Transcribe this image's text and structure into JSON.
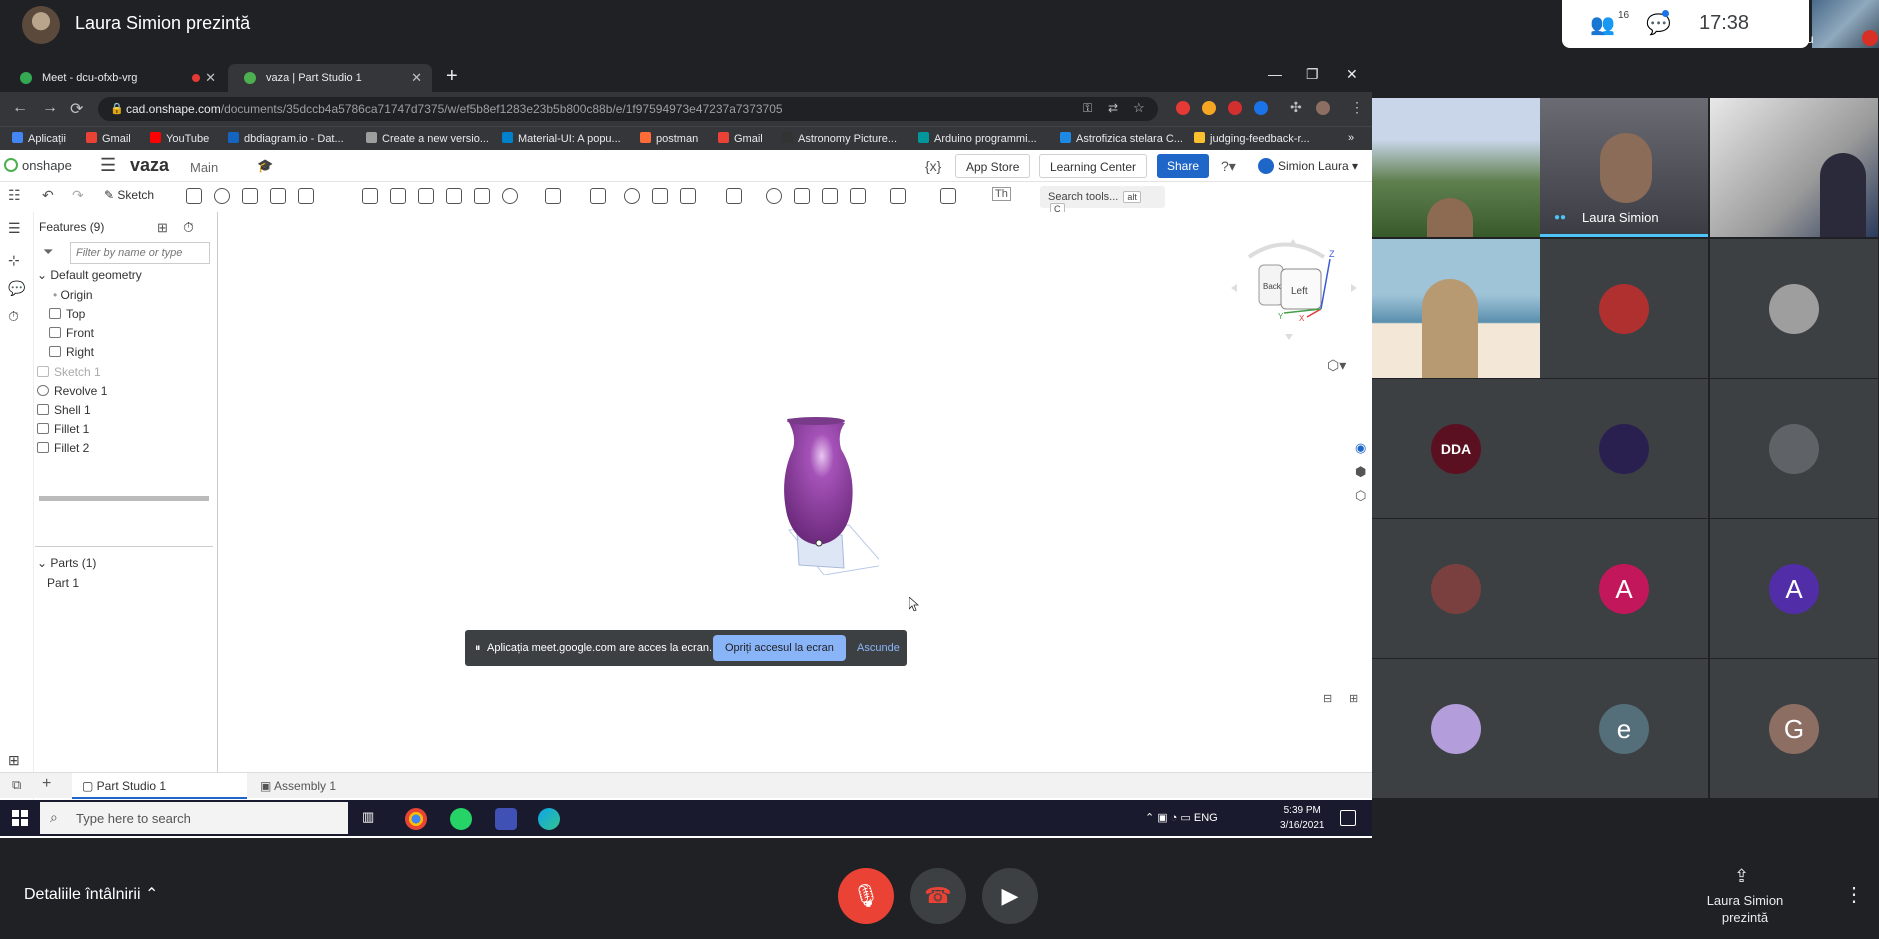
{
  "meet": {
    "presenter_title": "Laura Simion prezintă",
    "people_count": "16",
    "clock": "17:38",
    "self_label": "Tu",
    "details_label": "Detaliile întâlnirii",
    "present_label": "Laura Simion prezintă",
    "participants": {
      "speaker_name": "Laura Simion",
      "avatars": [
        {
          "letter": "",
          "color": "#b03030",
          "icon": "robot-avatar"
        },
        {
          "letter": "",
          "color": "#9e9e9e",
          "icon": "photo-avatar"
        },
        {
          "letter": "DDA",
          "color": "#5a1020"
        },
        {
          "letter": "",
          "color": "#2a2050",
          "icon": "anime-avatar"
        },
        {
          "letter": "",
          "color": "#5f6368"
        },
        {
          "letter": "",
          "color": "#7a4040",
          "icon": "car-avatar"
        },
        {
          "letter": "A",
          "color": "#c2185b"
        },
        {
          "letter": "A",
          "color": "#512da8"
        },
        {
          "letter": "",
          "color": "#b39ddb",
          "icon": "anime-avatar"
        },
        {
          "letter": "e",
          "color": "#546e7a"
        },
        {
          "letter": "G",
          "color": "#8d6e63"
        }
      ]
    }
  },
  "browser": {
    "tabs": [
      {
        "title": "Meet - dcu-ofxb-vrg",
        "active": false
      },
      {
        "title": "vaza | Part Studio 1",
        "active": true
      }
    ],
    "url_host": "cad.onshape.com",
    "url_path": "/documents/35dccb4a5786ca71747d7375/w/ef5b8ef1283e23b5b800c88b/e/1f97594973e47237a7373705",
    "bookmarks": [
      "Aplicații",
      "Gmail",
      "YouTube",
      "dbdiagram.io - Dat...",
      "Create a new versio...",
      "Material-UI: A popu...",
      "postman",
      "Gmail",
      "Astronomy Picture...",
      "Arduino programmi...",
      "Astrofizica stelara C...",
      "judging-feedback-r..."
    ],
    "bookmarks_more": "»"
  },
  "onshape": {
    "logo": "onshape",
    "doc_name": "vaza",
    "branch": "Main",
    "app_store": "App Store",
    "learning_center": "Learning Center",
    "share": "Share",
    "user": "Simion Laura",
    "sketch_label": "Sketch",
    "search_tools": "Search tools...",
    "search_kbd1": "alt",
    "search_kbd2": "C",
    "th_label": "Th",
    "features_title": "Features (9)",
    "filter_placeholder": "Filter by name or type",
    "default_geometry": "Default geometry",
    "features": [
      "Origin",
      "Top",
      "Front",
      "Right",
      "Sketch 1",
      "Revolve 1",
      "Shell 1",
      "Fillet 1",
      "Fillet 2"
    ],
    "parts_title": "Parts (1)",
    "parts": [
      "Part 1"
    ],
    "viewcube_back": "Back",
    "viewcube_left": "Left",
    "axis_z": "Z",
    "axis_x": "X",
    "axis_y": "Y",
    "bottom_tab_active": "Part Studio 1",
    "bottom_tab_other": "Assembly 1",
    "vase_color": "#8e3c9c"
  },
  "share_banner": {
    "message": "Aplicația meet.google.com are acces la ecran.",
    "stop": "Opriți accesul la ecran",
    "hide": "Ascunde"
  },
  "taskbar": {
    "search": "Type here to search",
    "lang": "ENG",
    "time": "5:39 PM",
    "date": "3/16/2021"
  }
}
